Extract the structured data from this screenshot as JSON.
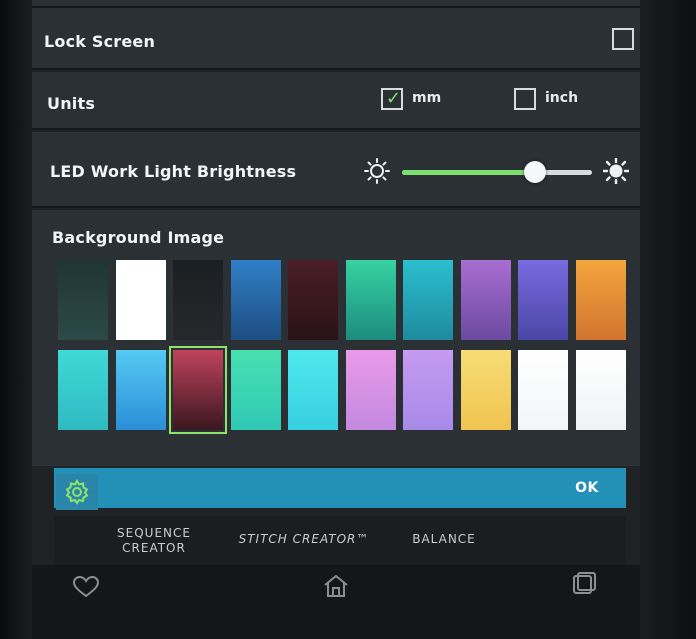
{
  "settings": {
    "lock_screen": {
      "label": "Lock Screen",
      "checked": false
    },
    "units": {
      "label": "Units",
      "options": [
        {
          "label": "mm",
          "checked": true
        },
        {
          "label": "inch",
          "checked": false
        }
      ]
    },
    "led_brightness": {
      "label": "LED Work Light Brightness",
      "value_fraction": 0.7
    },
    "background_image": {
      "label": "Background Image",
      "selected_index": 12,
      "swatches": [
        {
          "top": "#1f3533",
          "bottom": "#2c4a48"
        },
        {
          "top": "#ffffff",
          "bottom": "#ffffff"
        },
        {
          "top": "#1c1f22",
          "bottom": "#25292c"
        },
        {
          "top": "#2f7fc6",
          "bottom": "#1e4e82"
        },
        {
          "top": "#4a1e26",
          "bottom": "#2a1216"
        },
        {
          "top": "#36d2a2",
          "bottom": "#1c8c7f"
        },
        {
          "top": "#2bbfcf",
          "bottom": "#1e8b9f"
        },
        {
          "top": "#a86ed2",
          "bottom": "#6b4aa0"
        },
        {
          "top": "#7a6ae0",
          "bottom": "#4a47a6"
        },
        {
          "top": "#f3a53c",
          "bottom": "#d27430"
        },
        {
          "top": "#3fd9d6",
          "bottom": "#2fbac2"
        },
        {
          "top": "#56c9f4",
          "bottom": "#2a8fd6"
        },
        {
          "top": "#c0435c",
          "bottom": "#3a1720"
        },
        {
          "top": "#48e0b0",
          "bottom": "#2fc9b6"
        },
        {
          "top": "#4fe8ec",
          "bottom": "#37cfe2"
        },
        {
          "top": "#e99ae8",
          "bottom": "#c389e0"
        },
        {
          "top": "#c59af0",
          "bottom": "#a88ae8"
        },
        {
          "top": "#f6dc76",
          "bottom": "#f0c450"
        },
        {
          "top": "#ffffff",
          "bottom": "#f3f5f7"
        },
        {
          "top": "#ffffff",
          "bottom": "#f0f2f4"
        }
      ]
    }
  },
  "bottom_bar": {
    "ok_label": "OK"
  },
  "tabs": [
    {
      "label": "SEQUENCE\nCREATOR",
      "italic": false
    },
    {
      "label": "STITCH CREATOR™",
      "italic": true
    },
    {
      "label": "BALANCE",
      "italic": false
    }
  ],
  "nav": {
    "icons": [
      "heart-icon",
      "home-icon",
      "recent-apps-icon"
    ]
  },
  "colors": {
    "accent_green": "#7ee070",
    "slider_fill": "#7be06e",
    "slider_rest": "#d7dcdf",
    "bar_blue": "#2390b8"
  }
}
